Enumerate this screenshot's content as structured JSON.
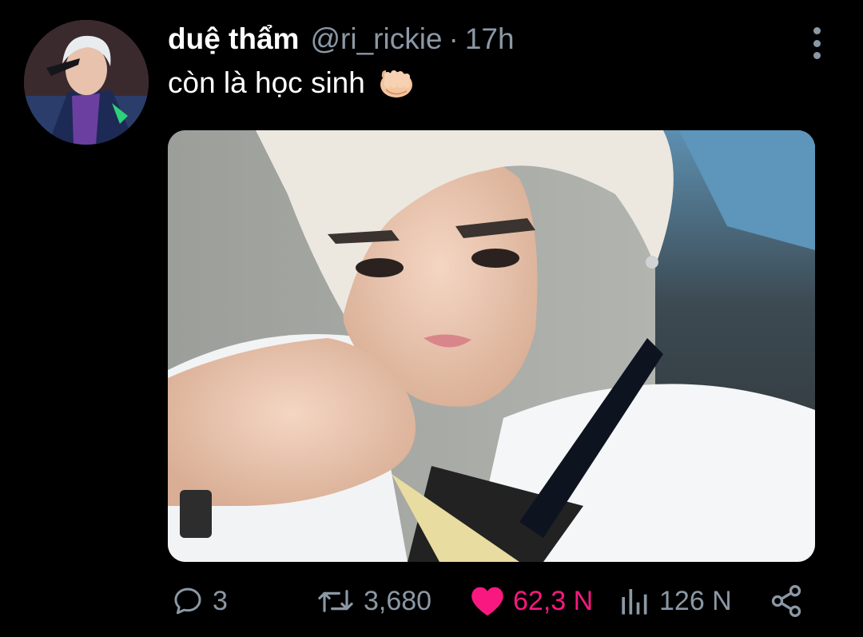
{
  "tweet": {
    "display_name": "duệ thẩm",
    "handle": "@ri_rickie",
    "separator": "·",
    "time": "17h",
    "text": "còn là học sinh",
    "emoji": "oncoming-fist-emoji"
  },
  "actions": {
    "reply_count": "3",
    "retweet_count": "3,680",
    "like_count": "62,3 N",
    "view_count": "126 N"
  },
  "colors": {
    "background": "#000000",
    "secondary_text": "#8b98a5",
    "like_active": "#f91880",
    "primary_text": "#ffffff"
  },
  "icons": {
    "more": "more-vertical-icon",
    "reply": "reply-icon",
    "retweet": "retweet-icon",
    "like": "heart-filled-icon",
    "views": "views-chart-icon",
    "share": "share-icon"
  }
}
